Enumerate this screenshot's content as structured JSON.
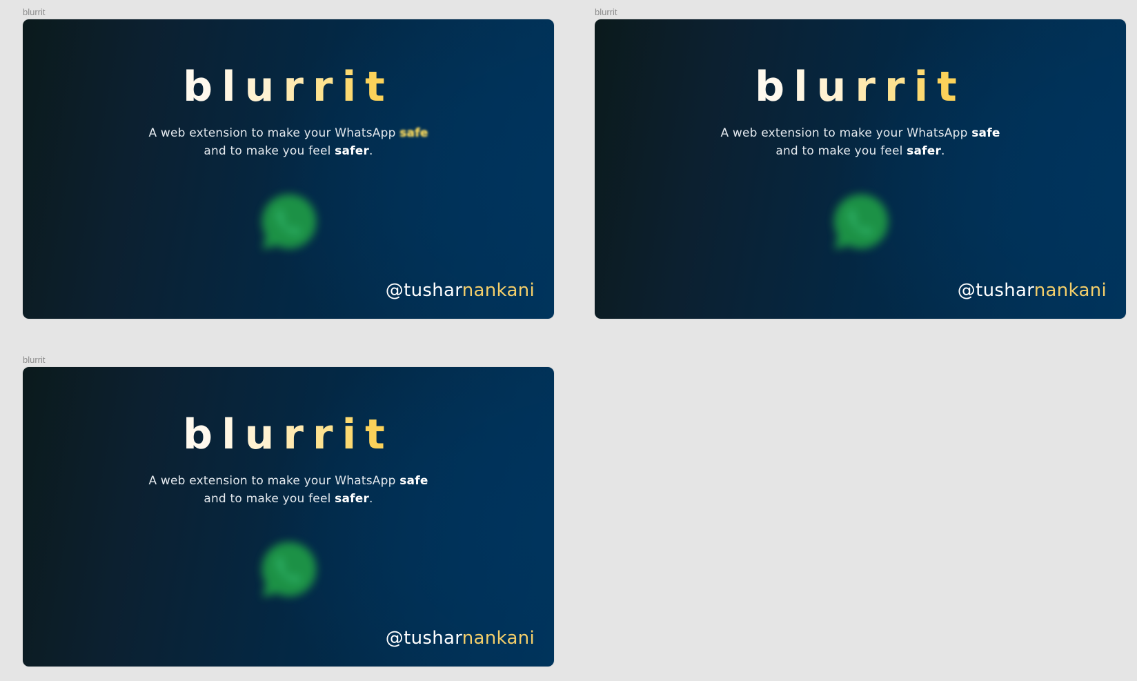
{
  "canvas": {
    "background": "#e5e5e5"
  },
  "frames": [
    {
      "label": "blurrit",
      "brand": [
        "b",
        "l",
        "u",
        "r",
        "r",
        "i",
        "t"
      ],
      "tagline": {
        "line1_prefix": "A web extension to make your WhatsApp ",
        "line1_highlight": "safe",
        "line1_highlight_blurred": true,
        "line2_prefix": "and to make you feel ",
        "line2_bold": "safer",
        "line2_suffix": "."
      },
      "icon": "whatsapp-logo-icon",
      "icon_blurred": true,
      "handle": {
        "first": "@tushar",
        "last": "nankani"
      }
    },
    {
      "label": "blurrit",
      "brand": [
        "b",
        "l",
        "u",
        "r",
        "r",
        "i",
        "t"
      ],
      "tagline": {
        "line1_prefix": "A web extension to make your WhatsApp ",
        "line1_highlight": "safe",
        "line1_highlight_blurred": false,
        "line2_prefix": "and to make you feel ",
        "line2_bold": "safer",
        "line2_suffix": "."
      },
      "icon": "whatsapp-logo-icon",
      "icon_blurred": true,
      "handle": {
        "first": "@tushar",
        "last": "nankani"
      }
    },
    {
      "label": "blurrit",
      "brand": [
        "b",
        "l",
        "u",
        "r",
        "r",
        "i",
        "t"
      ],
      "tagline": {
        "line1_prefix": "A web extension to make your WhatsApp ",
        "line1_highlight": "safe",
        "line1_highlight_blurred": false,
        "line2_prefix": "and to make you feel ",
        "line2_bold": "safer",
        "line2_suffix": "."
      },
      "icon": "whatsapp-logo-icon",
      "icon_blurred": true,
      "handle": {
        "first": "@tushar",
        "last": "nankani"
      }
    }
  ],
  "colors": {
    "frame_dark": "#0b1a1c",
    "frame_blue": "#003359",
    "brand_gold": "#fbd25a",
    "handle_gold": "#f5cf6a",
    "whatsapp_green": "#1f9d46"
  }
}
